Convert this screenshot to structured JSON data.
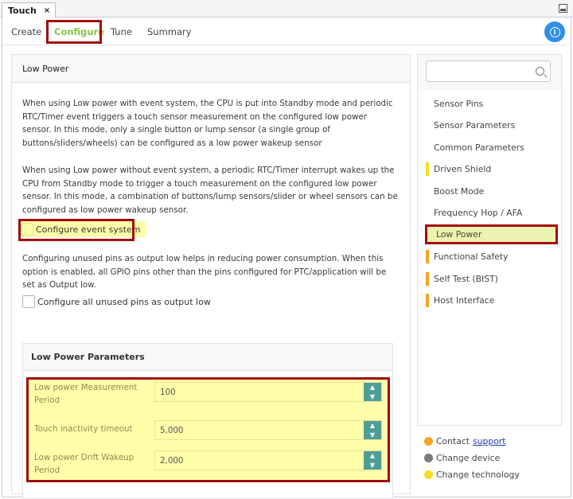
{
  "window": {
    "tab_title": "Touch",
    "close_glyph": "×"
  },
  "nav": {
    "items": [
      {
        "label": "Create",
        "active": false
      },
      {
        "label": "Configure",
        "active": true
      },
      {
        "label": "Tune",
        "active": false
      },
      {
        "label": "Summary",
        "active": false
      }
    ],
    "info_icon": "info-icon",
    "info_glyph": "i"
  },
  "main": {
    "title": "Low Power",
    "para1": "When using Low power with event system, the CPU is put into Standby mode and periodic RTC/Timer event triggers a touch sensor measurement on the configured low power sensor. In this mode, only a single button or lump sensor (a single group of buttons/sliders/wheels) can be configured as a low power wakeup sensor",
    "para2": "When using Low power without event system, a periodic RTC/Timer interrupt wakes up the CPU from Standby mode to trigger a touch measurement on the configured low power sensor. In this mode, a combination of buttons/lump sensors/slider or wheel sensors can be configured as low power wakeup sensor.",
    "check_event_system": {
      "label": "Configure event system",
      "checked": false
    },
    "para3": "Configuring unused pins as output low helps in reducing power consumption. When this option is enabled, all GPIO pins other than the pins configured for PTC/application will be set as Output low.",
    "check_unused_pins": {
      "label": "Configure all unused pins as output low",
      "checked": false
    }
  },
  "params": {
    "title": "Low Power Parameters",
    "fields": [
      {
        "label": "Low power Measurement Period",
        "value": "100"
      },
      {
        "label": "Touch inactivity timeout",
        "value": "5,000"
      },
      {
        "label": "Low power Drift Wakeup Period",
        "value": "2,000"
      }
    ],
    "spin_up": "▲",
    "spin_down": "▼"
  },
  "sidebar": {
    "search_placeholder": "",
    "items": [
      {
        "label": "Sensor Pins",
        "marker": ""
      },
      {
        "label": "Sensor Parameters",
        "marker": ""
      },
      {
        "label": "Common Parameters",
        "marker": ""
      },
      {
        "label": "Driven Shield",
        "marker": "#f5dd1f"
      },
      {
        "label": "Boost Mode",
        "marker": ""
      },
      {
        "label": "Frequency Hop / AFA",
        "marker": ""
      },
      {
        "label": "Low Power",
        "marker": "",
        "active": true
      },
      {
        "label": "Functional Safety",
        "marker": "#f5a623"
      },
      {
        "label": "Self Test (BIST)",
        "marker": "#f5a623"
      },
      {
        "label": "Host Interface",
        "marker": "#f5a623"
      }
    ]
  },
  "legend": {
    "contact_prefix": "Contact",
    "contact_link": "support",
    "change_device": "Change device",
    "change_technology": "Change technology",
    "colors": {
      "support": "#f5a623",
      "device": "#7a7a7a",
      "technology": "#f5dd1f"
    }
  },
  "colors": {
    "accent": "#8bc34a",
    "highlight": "#ffffaa",
    "annotation": "#a00e0e",
    "info": "#2f8ee7",
    "spinner": "#4e9e96"
  }
}
